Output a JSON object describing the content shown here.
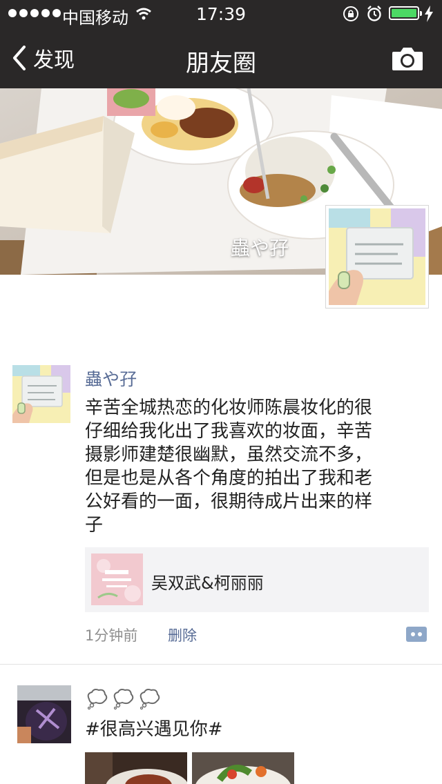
{
  "status_bar": {
    "carrier": "中国移动",
    "time": "17:39",
    "signal_dots": 5,
    "battery_fill": 1.0
  },
  "nav": {
    "back_label": "发现",
    "title": "朋友圈",
    "camera_icon": "camera-icon"
  },
  "cover": {
    "name": "蟲や孖"
  },
  "posts": [
    {
      "author": "蟲や孖",
      "text_lines": [
        "辛苦全城热恋的化妆师陈晨妆化的很",
        "仔细给我化出了我喜欢的妆面，辛苦",
        "摄影师建楚很幽默，虽然交流不多，",
        "但是也是从各个角度的拍出了我和老",
        "公好看的一面，很期待成片出来的样",
        "子"
      ],
      "link": {
        "title": "吴双武&柯丽丽"
      },
      "time_ago": "1分钟前",
      "delete_label": "删除"
    },
    {
      "author": "",
      "emoji_count": 3,
      "text": "#很高兴遇见你#"
    }
  ],
  "colors": {
    "nav_bg": "#2a2828",
    "link_blue": "#576b95",
    "battery_green": "#4cd964"
  }
}
